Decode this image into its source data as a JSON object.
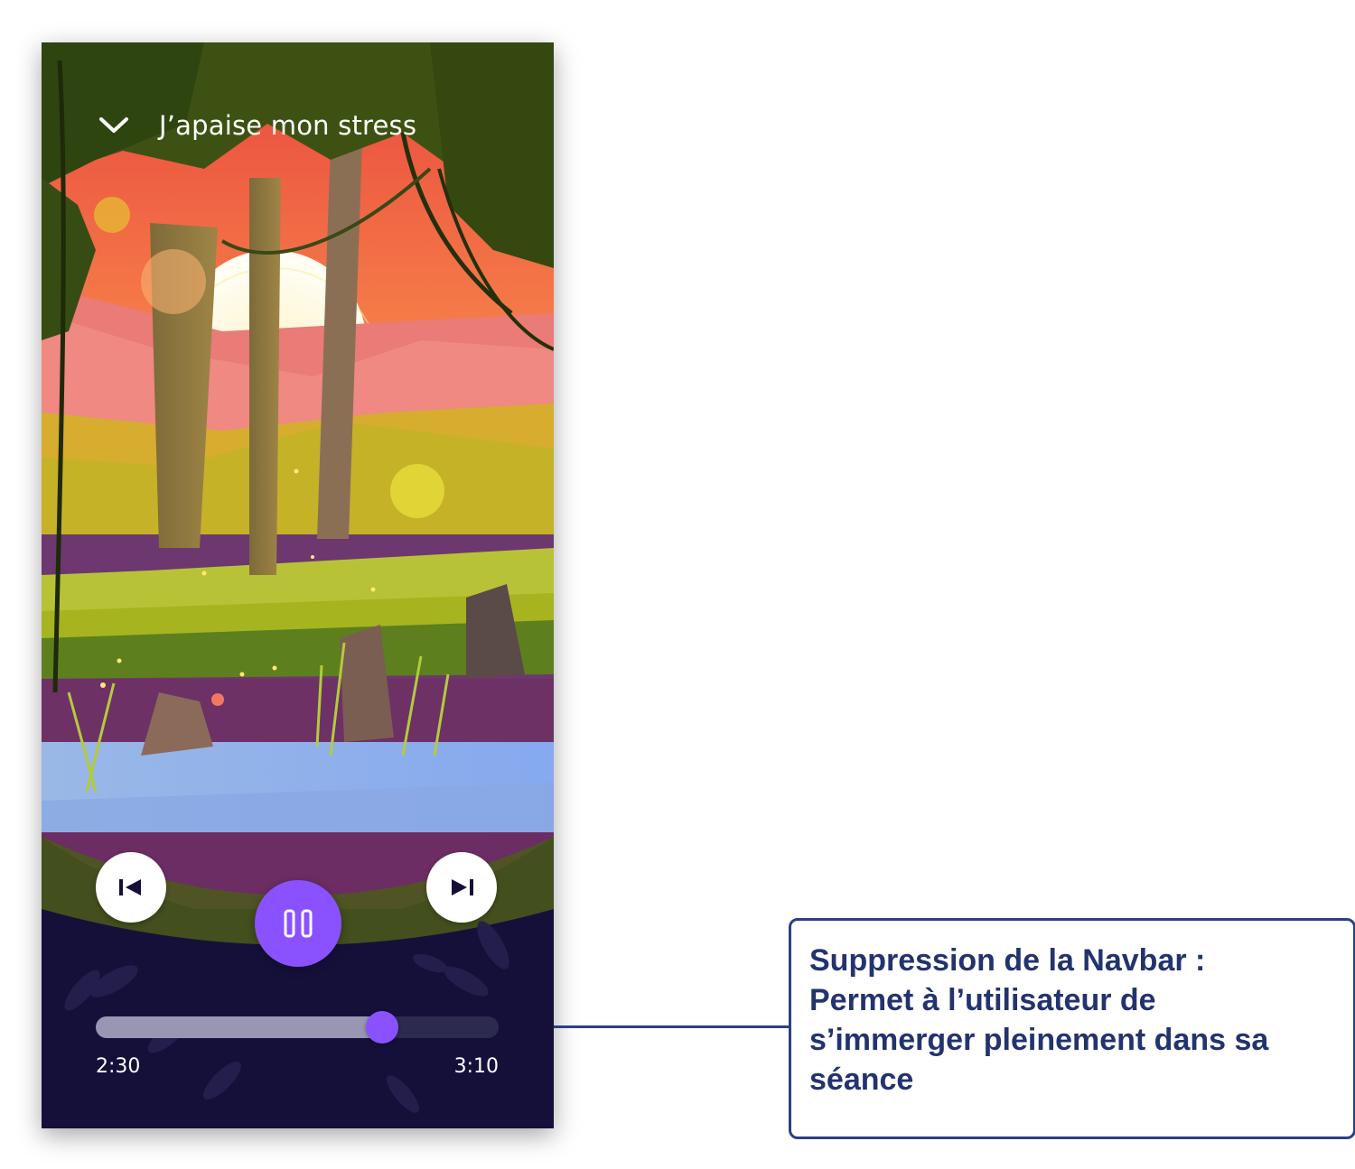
{
  "player": {
    "title": "J’apaise mon stress",
    "current_time": "2:30",
    "total_time": "3:10",
    "progress": 0.71,
    "state": "playing"
  },
  "icons": {
    "back": "chevron-down-icon",
    "previous": "skip-previous-icon",
    "pause": "pause-icon",
    "next": "skip-next-icon"
  },
  "annotation": {
    "text": "Suppression de la Navbar :\nPermet à l’utilisateur de\ns’immerger pleinement dans sa\nséance"
  },
  "colors": {
    "accent": "#8a52ff",
    "panel": "#15103a",
    "annotation": "#2c3f86"
  }
}
